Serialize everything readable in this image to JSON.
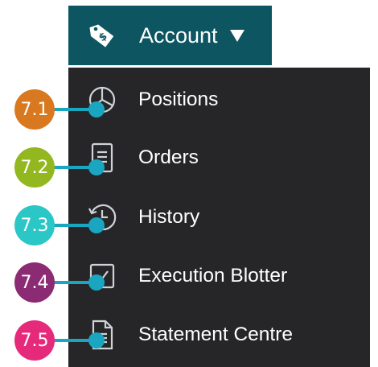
{
  "colors": {
    "account_bg": "#0d5561",
    "menu_bg": "#262629",
    "connector": "#1aa6c0",
    "icon_stroke": "#cfd3d6"
  },
  "account": {
    "label": "Account",
    "icon": "price-tag-dollar-icon",
    "caret": "caret-down-icon"
  },
  "menu": {
    "items": [
      {
        "label": "Positions",
        "icon": "pie-chart-icon"
      },
      {
        "label": "Orders",
        "icon": "document-lines-icon"
      },
      {
        "label": "History",
        "icon": "history-clock-icon"
      },
      {
        "label": "Execution Blotter",
        "icon": "checkbox-icon"
      },
      {
        "label": "Statement Centre",
        "icon": "statement-document-icon"
      }
    ]
  },
  "annotations": [
    {
      "number": "7.1",
      "color": "#d9791f"
    },
    {
      "number": "7.2",
      "color": "#93b81f"
    },
    {
      "number": "7.3",
      "color": "#2bc7c7"
    },
    {
      "number": "7.4",
      "color": "#8b2b74"
    },
    {
      "number": "7.5",
      "color": "#e62a7b"
    }
  ]
}
